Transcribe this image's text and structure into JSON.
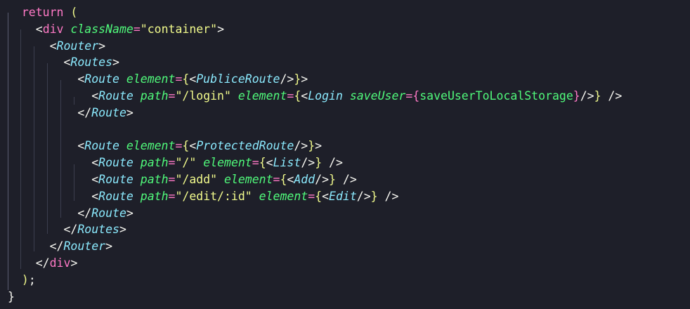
{
  "editor": {
    "lines": [
      [
        {
          "t": "  "
        },
        {
          "t": "return",
          "c": "kw"
        },
        {
          "t": " "
        },
        {
          "t": "(",
          "c": "p1"
        }
      ],
      [
        {
          "t": "    "
        },
        {
          "t": "<"
        },
        {
          "t": "div",
          "c": "tagp"
        },
        {
          "t": " "
        },
        {
          "t": "className",
          "c": "attr"
        },
        {
          "t": "=",
          "c": "op"
        },
        {
          "t": "\"container\"",
          "c": "str"
        },
        {
          "t": ">"
        }
      ],
      [
        {
          "t": "      "
        },
        {
          "t": "<"
        },
        {
          "t": "Router",
          "c": "tag"
        },
        {
          "t": ">"
        }
      ],
      [
        {
          "t": "        "
        },
        {
          "t": "<"
        },
        {
          "t": "Routes",
          "c": "tag"
        },
        {
          "t": ">"
        }
      ],
      [
        {
          "t": "          "
        },
        {
          "t": "<"
        },
        {
          "t": "Route",
          "c": "tag"
        },
        {
          "t": " "
        },
        {
          "t": "element",
          "c": "attr"
        },
        {
          "t": "=",
          "c": "op"
        },
        {
          "t": "{",
          "c": "p1"
        },
        {
          "t": "<"
        },
        {
          "t": "PubliceRoute",
          "c": "tag"
        },
        {
          "t": "/>"
        },
        {
          "t": "}",
          "c": "p1"
        },
        {
          "t": ">"
        }
      ],
      [
        {
          "t": "            "
        },
        {
          "t": "<"
        },
        {
          "t": "Route",
          "c": "tag"
        },
        {
          "t": " "
        },
        {
          "t": "path",
          "c": "attr"
        },
        {
          "t": "=",
          "c": "op"
        },
        {
          "t": "\"/login\"",
          "c": "str"
        },
        {
          "t": " "
        },
        {
          "t": "element",
          "c": "attr"
        },
        {
          "t": "=",
          "c": "op"
        },
        {
          "t": "{",
          "c": "p1"
        },
        {
          "t": "<"
        },
        {
          "t": "Login",
          "c": "tag"
        },
        {
          "t": " "
        },
        {
          "t": "saveUser",
          "c": "attr"
        },
        {
          "t": "=",
          "c": "op"
        },
        {
          "t": "{",
          "c": "p2"
        },
        {
          "t": "saveUserToLocalStorage",
          "c": "fn"
        },
        {
          "t": "}",
          "c": "p2"
        },
        {
          "t": "/>"
        },
        {
          "t": "}",
          "c": "p1"
        },
        {
          "t": " />"
        }
      ],
      [
        {
          "t": "          "
        },
        {
          "t": "</"
        },
        {
          "t": "Route",
          "c": "tag"
        },
        {
          "t": ">"
        }
      ],
      [],
      [
        {
          "t": "          "
        },
        {
          "t": "<"
        },
        {
          "t": "Route",
          "c": "tag"
        },
        {
          "t": " "
        },
        {
          "t": "element",
          "c": "attr"
        },
        {
          "t": "=",
          "c": "op"
        },
        {
          "t": "{",
          "c": "p1"
        },
        {
          "t": "<"
        },
        {
          "t": "ProtectedRoute",
          "c": "tag"
        },
        {
          "t": "/>"
        },
        {
          "t": "}",
          "c": "p1"
        },
        {
          "t": ">"
        }
      ],
      [
        {
          "t": "            "
        },
        {
          "t": "<"
        },
        {
          "t": "Route",
          "c": "tag"
        },
        {
          "t": " "
        },
        {
          "t": "path",
          "c": "attr"
        },
        {
          "t": "=",
          "c": "op"
        },
        {
          "t": "\"/\"",
          "c": "str"
        },
        {
          "t": " "
        },
        {
          "t": "element",
          "c": "attr"
        },
        {
          "t": "=",
          "c": "op"
        },
        {
          "t": "{",
          "c": "p1"
        },
        {
          "t": "<"
        },
        {
          "t": "List",
          "c": "tag"
        },
        {
          "t": "/>"
        },
        {
          "t": "}",
          "c": "p1"
        },
        {
          "t": " />"
        }
      ],
      [
        {
          "t": "            "
        },
        {
          "t": "<"
        },
        {
          "t": "Route",
          "c": "tag"
        },
        {
          "t": " "
        },
        {
          "t": "path",
          "c": "attr"
        },
        {
          "t": "=",
          "c": "op"
        },
        {
          "t": "\"/add\"",
          "c": "str"
        },
        {
          "t": " "
        },
        {
          "t": "element",
          "c": "attr"
        },
        {
          "t": "=",
          "c": "op"
        },
        {
          "t": "{",
          "c": "p1"
        },
        {
          "t": "<"
        },
        {
          "t": "Add",
          "c": "tag"
        },
        {
          "t": "/>"
        },
        {
          "t": "}",
          "c": "p1"
        },
        {
          "t": " />"
        }
      ],
      [
        {
          "t": "            "
        },
        {
          "t": "<"
        },
        {
          "t": "Route",
          "c": "tag"
        },
        {
          "t": " "
        },
        {
          "t": "path",
          "c": "attr"
        },
        {
          "t": "=",
          "c": "op"
        },
        {
          "t": "\"/edit/:id\"",
          "c": "str"
        },
        {
          "t": " "
        },
        {
          "t": "element",
          "c": "attr"
        },
        {
          "t": "=",
          "c": "op"
        },
        {
          "t": "{",
          "c": "p1"
        },
        {
          "t": "<"
        },
        {
          "t": "Edit",
          "c": "tag"
        },
        {
          "t": "/>"
        },
        {
          "t": "}",
          "c": "p1"
        },
        {
          "t": " />"
        }
      ],
      [
        {
          "t": "          "
        },
        {
          "t": "</"
        },
        {
          "t": "Route",
          "c": "tag"
        },
        {
          "t": ">"
        }
      ],
      [
        {
          "t": "        "
        },
        {
          "t": "</"
        },
        {
          "t": "Routes",
          "c": "tag"
        },
        {
          "t": ">"
        }
      ],
      [
        {
          "t": "      "
        },
        {
          "t": "</"
        },
        {
          "t": "Router",
          "c": "tag"
        },
        {
          "t": ">"
        }
      ],
      [
        {
          "t": "    "
        },
        {
          "t": "</"
        },
        {
          "t": "div",
          "c": "tagp"
        },
        {
          "t": ">"
        }
      ],
      [
        {
          "t": "  "
        },
        {
          "t": ")",
          "c": "p1"
        },
        {
          "t": ";"
        }
      ],
      [
        {
          "t": "}",
          "c": "brace"
        }
      ]
    ]
  }
}
